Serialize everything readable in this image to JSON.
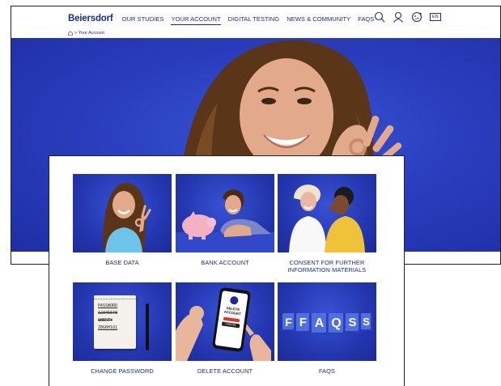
{
  "brand": "Beiersdorf",
  "nav": {
    "items": [
      {
        "label": "OUR STUDIES",
        "active": false
      },
      {
        "label": "YOUR ACCOUNT",
        "active": true
      },
      {
        "label": "DIGITAL TESTING",
        "active": false
      },
      {
        "label": "NEWS & COMMUNITY",
        "active": false
      },
      {
        "label": "FAQS",
        "active": false
      }
    ],
    "icons": [
      "search-icon",
      "user-icon",
      "cookie-icon",
      "language-icon"
    ],
    "language": "EN"
  },
  "breadcrumb": {
    "current": "Your Account"
  },
  "colors": {
    "brand_blue": "#1e2a8c",
    "hero_blue": "#2a3fbf"
  },
  "tiles": [
    {
      "label": "BASE DATA"
    },
    {
      "label": "BANK ACCOUNT"
    },
    {
      "label": "CONSENT FOR FURTHER INFORMATION MATERIALS"
    },
    {
      "label": "CHANGE PASSWORD"
    },
    {
      "label": "DELETE ACCOUNT"
    },
    {
      "label": "FAQS"
    }
  ],
  "password_note": {
    "line1": "PASSWORD",
    "line2": "12345678",
    "line3": "QWERTY",
    "line4": "Z8G6H1Q1"
  },
  "phone_screen": {
    "line1": "DELETE",
    "line2": "ACCOUNT",
    "button": "CANCEL"
  },
  "faq_blocks": [
    "F",
    "F",
    "A",
    "Q",
    "S",
    "S"
  ]
}
